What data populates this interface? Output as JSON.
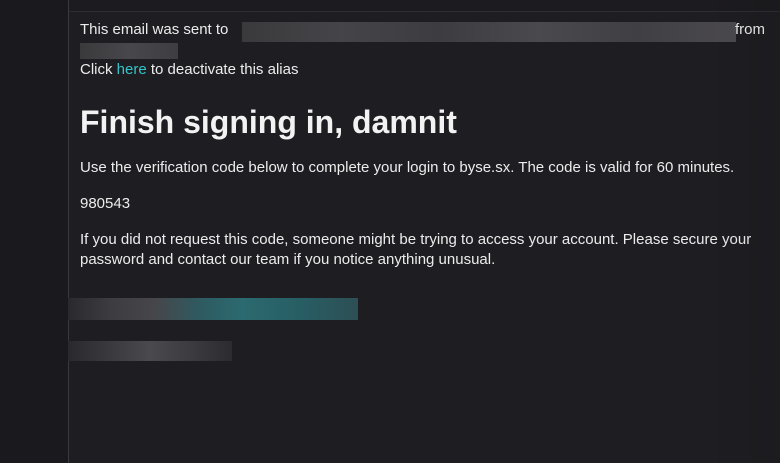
{
  "email": {
    "sent_prefix": "This email was sent to",
    "sent_from": "from",
    "click_prefix": "Click ",
    "click_link": "here",
    "click_suffix": " to deactivate this alias",
    "heading": "Finish signing in, damnit",
    "verify_text": "Use the verification code below to complete your login to byse.sx. The code is valid for 60 minutes.",
    "code": "980543",
    "warning_text": "If you did not request this code, someone might be trying to access your account. Please secure your password and contact our team if you notice anything unusual.",
    "colors": {
      "link": "#34c3c9",
      "background": "#1e1d21",
      "text": "#ececed"
    }
  }
}
